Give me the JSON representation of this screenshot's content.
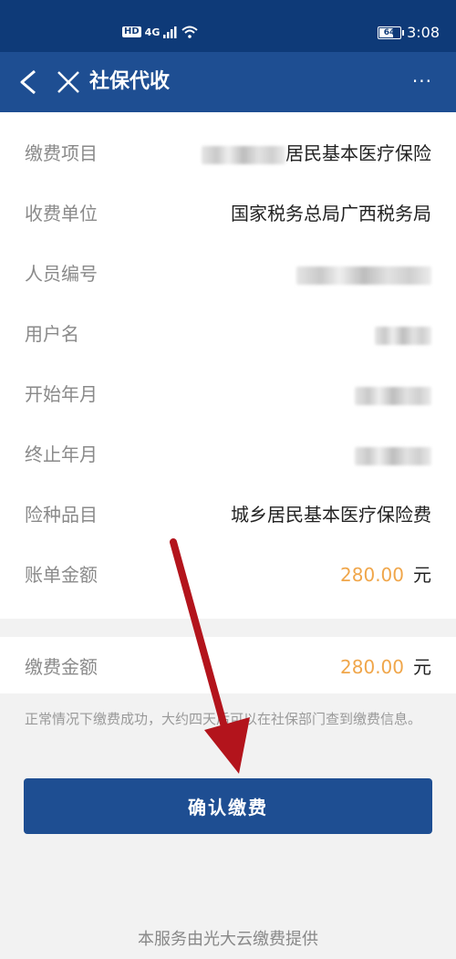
{
  "status_bar": {
    "network_badge": "HD",
    "network_type": "4G",
    "battery": "64",
    "battery_level": 0.64,
    "time": "3:08"
  },
  "nav": {
    "title": "社保代收",
    "more": "···"
  },
  "details": [
    {
      "label": "缴费项目",
      "value": "居民基本医疗保险",
      "redacted_prefix": true
    },
    {
      "label": "收费单位",
      "value": "国家税务总局广西税务局"
    },
    {
      "label": "人员编号",
      "value": "",
      "redacted": true
    },
    {
      "label": "用户名",
      "value": "",
      "redacted": true
    },
    {
      "label": "开始年月",
      "value": "",
      "redacted": true
    },
    {
      "label": "终止年月",
      "value": "",
      "redacted": true
    },
    {
      "label": "险种品目",
      "value": "城乡居民基本医疗保险费"
    },
    {
      "label": "账单金额",
      "amount": "280.00",
      "unit": "元"
    }
  ],
  "payment": {
    "label": "缴费金额",
    "amount": "280.00",
    "unit": "元"
  },
  "note": "正常情况下缴费成功，大约四天后可以在社保部门查到缴费信息。",
  "confirm_label": "确认缴费",
  "footer": "本服务由光大云缴费提供",
  "colors": {
    "status_bar": "#0e3a78",
    "nav_bar": "#1e4e92",
    "button": "#1e4e92",
    "amount": "#f0a64a",
    "annotation_arrow": "#b3141c"
  }
}
